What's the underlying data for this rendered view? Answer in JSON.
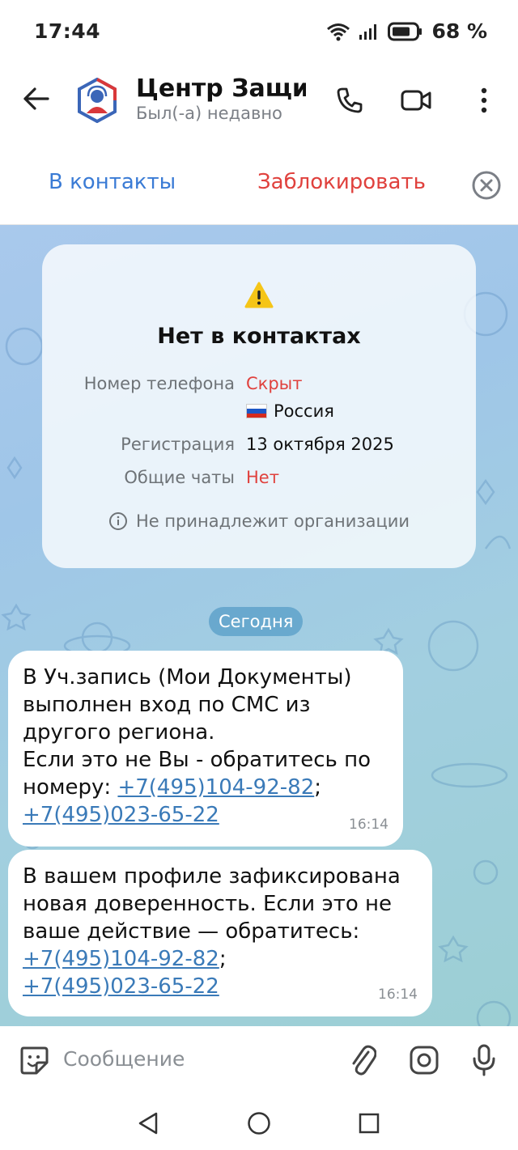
{
  "status_bar": {
    "time": "17:44",
    "battery": "68 %"
  },
  "header": {
    "title": "Центр Защи…",
    "subtitle": "Был(-а) недавно",
    "icons": [
      "back-arrow-icon",
      "phone-icon",
      "video-call-icon",
      "more-vertical-icon"
    ]
  },
  "action_bar": {
    "add_contact": "В контакты",
    "block": "Заблокировать"
  },
  "info_card": {
    "title": "Нет в контактах",
    "phone_label": "Номер телефона",
    "phone_value": "Скрыт",
    "country": "Россия",
    "registration_label": "Регистрация",
    "registration_value": "13 октября 2025",
    "common_chats_label": "Общие чаты",
    "common_chats_value": "Нет",
    "org_note": "Не принадлежит организации"
  },
  "date_separator": "Сегодня",
  "messages": [
    {
      "text": "В Уч.запись (Мои Документы)\nвыполнен вход по СМС из\nдругого региона.\nЕсли это не Вы - обратитесь по\nномеру: ",
      "link1": "+7(495)104-92-82",
      "sep": ";",
      "link2": "+7(495)023-65-22",
      "time": "16:14"
    },
    {
      "text": "В вашем профиле зафиксирована\nновая доверенность. Если это не\nваше действие — обратитесь:\n",
      "link1": "+7(495)104-92-82",
      "sep": ";",
      "link2": "+7(495)023-65-22",
      "time": "16:14"
    }
  ],
  "composer": {
    "placeholder": "Сообщение"
  },
  "colors": {
    "accent": "#3a7bd5",
    "danger": "#e0413d",
    "link": "#3a7ab8"
  }
}
